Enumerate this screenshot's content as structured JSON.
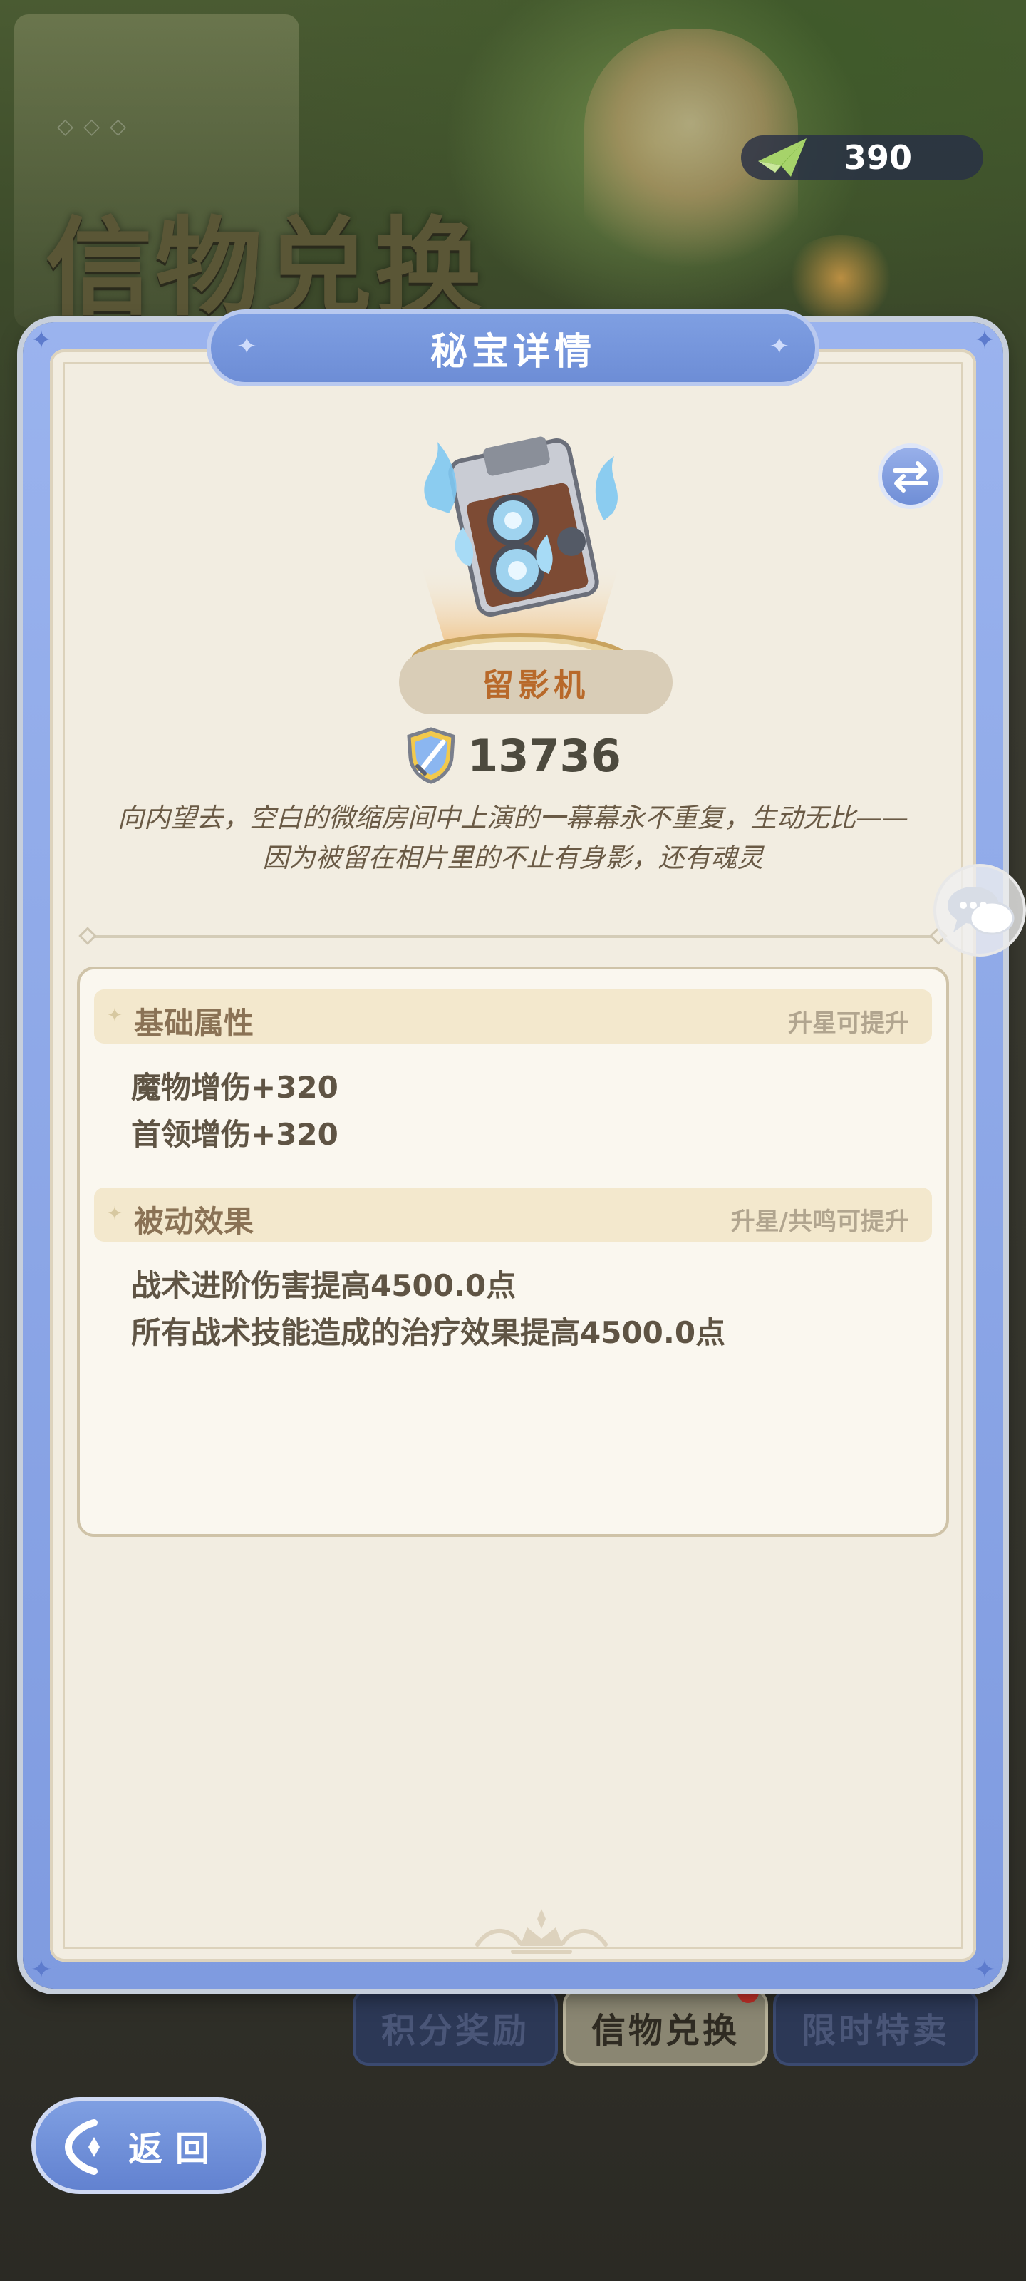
{
  "page": {
    "background_title": "信物兑换",
    "currency": {
      "icon": "paper-plane-icon",
      "value": "390"
    },
    "bottom_tabs": [
      {
        "label": "积分奖励"
      },
      {
        "label": "信物兑换"
      },
      {
        "label": "限时特卖"
      }
    ]
  },
  "modal": {
    "title": "秘宝详情",
    "swap_icon": "swap-arrows-icon",
    "item": {
      "name": "留影机",
      "image": "camera-relic-icon",
      "power_icon": "shield-sword-icon",
      "power": "13736",
      "description": "向内望去，空白的微缩房间中上演的一幕幕永不重复，生动无比——因为被留在相片里的不止有身影，还有魂灵"
    },
    "sections": {
      "basic": {
        "title": "基础属性",
        "note": "升星可提升",
        "lines": [
          "魔物增伤+320",
          "首领增伤+320"
        ]
      },
      "passive": {
        "title": "被动效果",
        "note": "升星/共鸣可提升",
        "lines": [
          "战术进阶伤害提高4500.0点",
          "所有战术技能造成的治疗效果提高4500.0点"
        ]
      }
    }
  },
  "back_button": {
    "label": "返回",
    "icon": "back-arrow-icon"
  },
  "chat": {
    "icon": "chat-bubbles-icon"
  },
  "colors": {
    "accent_blue": "#7f9fe2",
    "panel_cream": "#f2ede1",
    "item_name": "#b8692a"
  }
}
